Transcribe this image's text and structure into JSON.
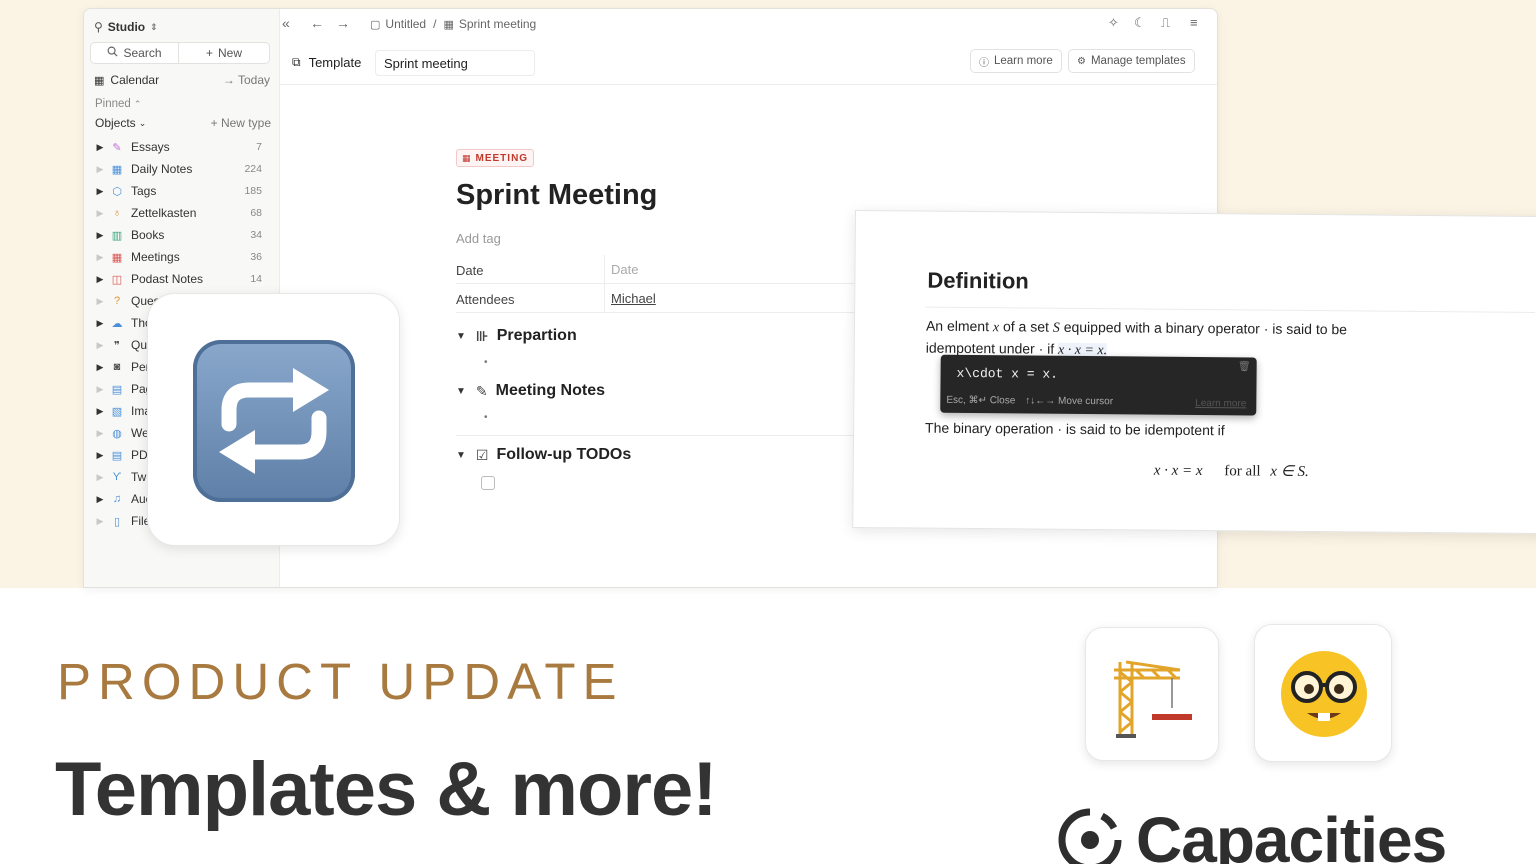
{
  "sidebar": {
    "workspace": "Studio",
    "search_label": "Search",
    "new_label": "New",
    "calendar_label": "Calendar",
    "today_label": "Today",
    "pinned_label": "Pinned",
    "objects_label": "Objects",
    "new_type_label": "New type",
    "items": [
      {
        "label": "Essays",
        "count": "7",
        "icon": "feather-icon",
        "color": "#c46dd6"
      },
      {
        "label": "Daily Notes",
        "count": "224",
        "icon": "calendar-icon",
        "color": "#4a90d9"
      },
      {
        "label": "Tags",
        "count": "185",
        "icon": "tag-icon",
        "color": "#4a90d9"
      },
      {
        "label": "Zettelkasten",
        "count": "68",
        "icon": "bulb-icon",
        "color": "#e0952c"
      },
      {
        "label": "Books",
        "count": "34",
        "icon": "books-icon",
        "color": "#3aa37a"
      },
      {
        "label": "Meetings",
        "count": "36",
        "icon": "calendar-icon",
        "color": "#d9534f"
      },
      {
        "label": "Podast Notes",
        "count": "14",
        "icon": "chat-icon",
        "color": "#d9534f"
      },
      {
        "label": "Questic",
        "count": "",
        "icon": "question-icon",
        "color": "#e0952c"
      },
      {
        "label": "Tho",
        "count": "",
        "icon": "cloud-icon",
        "color": "#4a90d9"
      },
      {
        "label": "Qu",
        "count": "",
        "icon": "quote-icon",
        "color": "#555555"
      },
      {
        "label": "Per",
        "count": "",
        "icon": "person-icon",
        "color": "#555555"
      },
      {
        "label": "Pag",
        "count": "",
        "icon": "page-icon",
        "color": "#4a90d9"
      },
      {
        "label": "Ima",
        "count": "",
        "icon": "image-icon",
        "color": "#4a90d9"
      },
      {
        "label": "We",
        "count": "",
        "icon": "globe-icon",
        "color": "#4a90d9"
      },
      {
        "label": "PDI",
        "count": "",
        "icon": "pdf-icon",
        "color": "#4a90d9"
      },
      {
        "label": "Twi",
        "count": "",
        "icon": "bird-icon",
        "color": "#4a90d9"
      },
      {
        "label": "Auc",
        "count": "",
        "icon": "audio-icon",
        "color": "#4a90d9"
      },
      {
        "label": "File",
        "count": "",
        "icon": "file-icon",
        "color": "#4a90d9"
      }
    ]
  },
  "topbar": {
    "crumb_1": "Untitled",
    "separator": "/",
    "crumb_2": "Sprint meeting"
  },
  "template_bar": {
    "label": "Template",
    "name_value": "Sprint meeting",
    "learn_more": "Learn more",
    "manage_templates": "Manage templates"
  },
  "document": {
    "type_tag": "MEETING",
    "title": "Sprint Meeting",
    "add_tag": "Add tag",
    "props": [
      {
        "name": "Date",
        "value": "Date"
      },
      {
        "name": "Attendees",
        "value": "Michael"
      }
    ],
    "sections": [
      "Prepartion",
      "Meeting Notes",
      "Follow-up TODOs"
    ]
  },
  "definition": {
    "title": "Definition",
    "p1_a": "An elment",
    "p1_b": "of a set",
    "p1_c": "equipped with a binary operator · is said to be idempotent under · if",
    "var_x": "x",
    "var_S": "S",
    "eq": "x · x = x.",
    "code": "x\\cdot x = x.",
    "hint_close": "Esc, ⌘↵ Close",
    "hint_move": "↑↓←→ Move cursor",
    "hint_learn": "Learn more",
    "p2": "The binary operation · is said to be idempotent if",
    "math_left": "x · x = x",
    "math_mid": "for all",
    "math_right": "x ∈ S."
  },
  "bottom": {
    "kicker": "PRODUCT UPDATE",
    "headline": "Templates & more!",
    "brand": "Capacities"
  },
  "colors": {
    "accent": "#a87a3f",
    "top_background": "#fbf3e3",
    "meeting_tag": "#c0392b"
  }
}
